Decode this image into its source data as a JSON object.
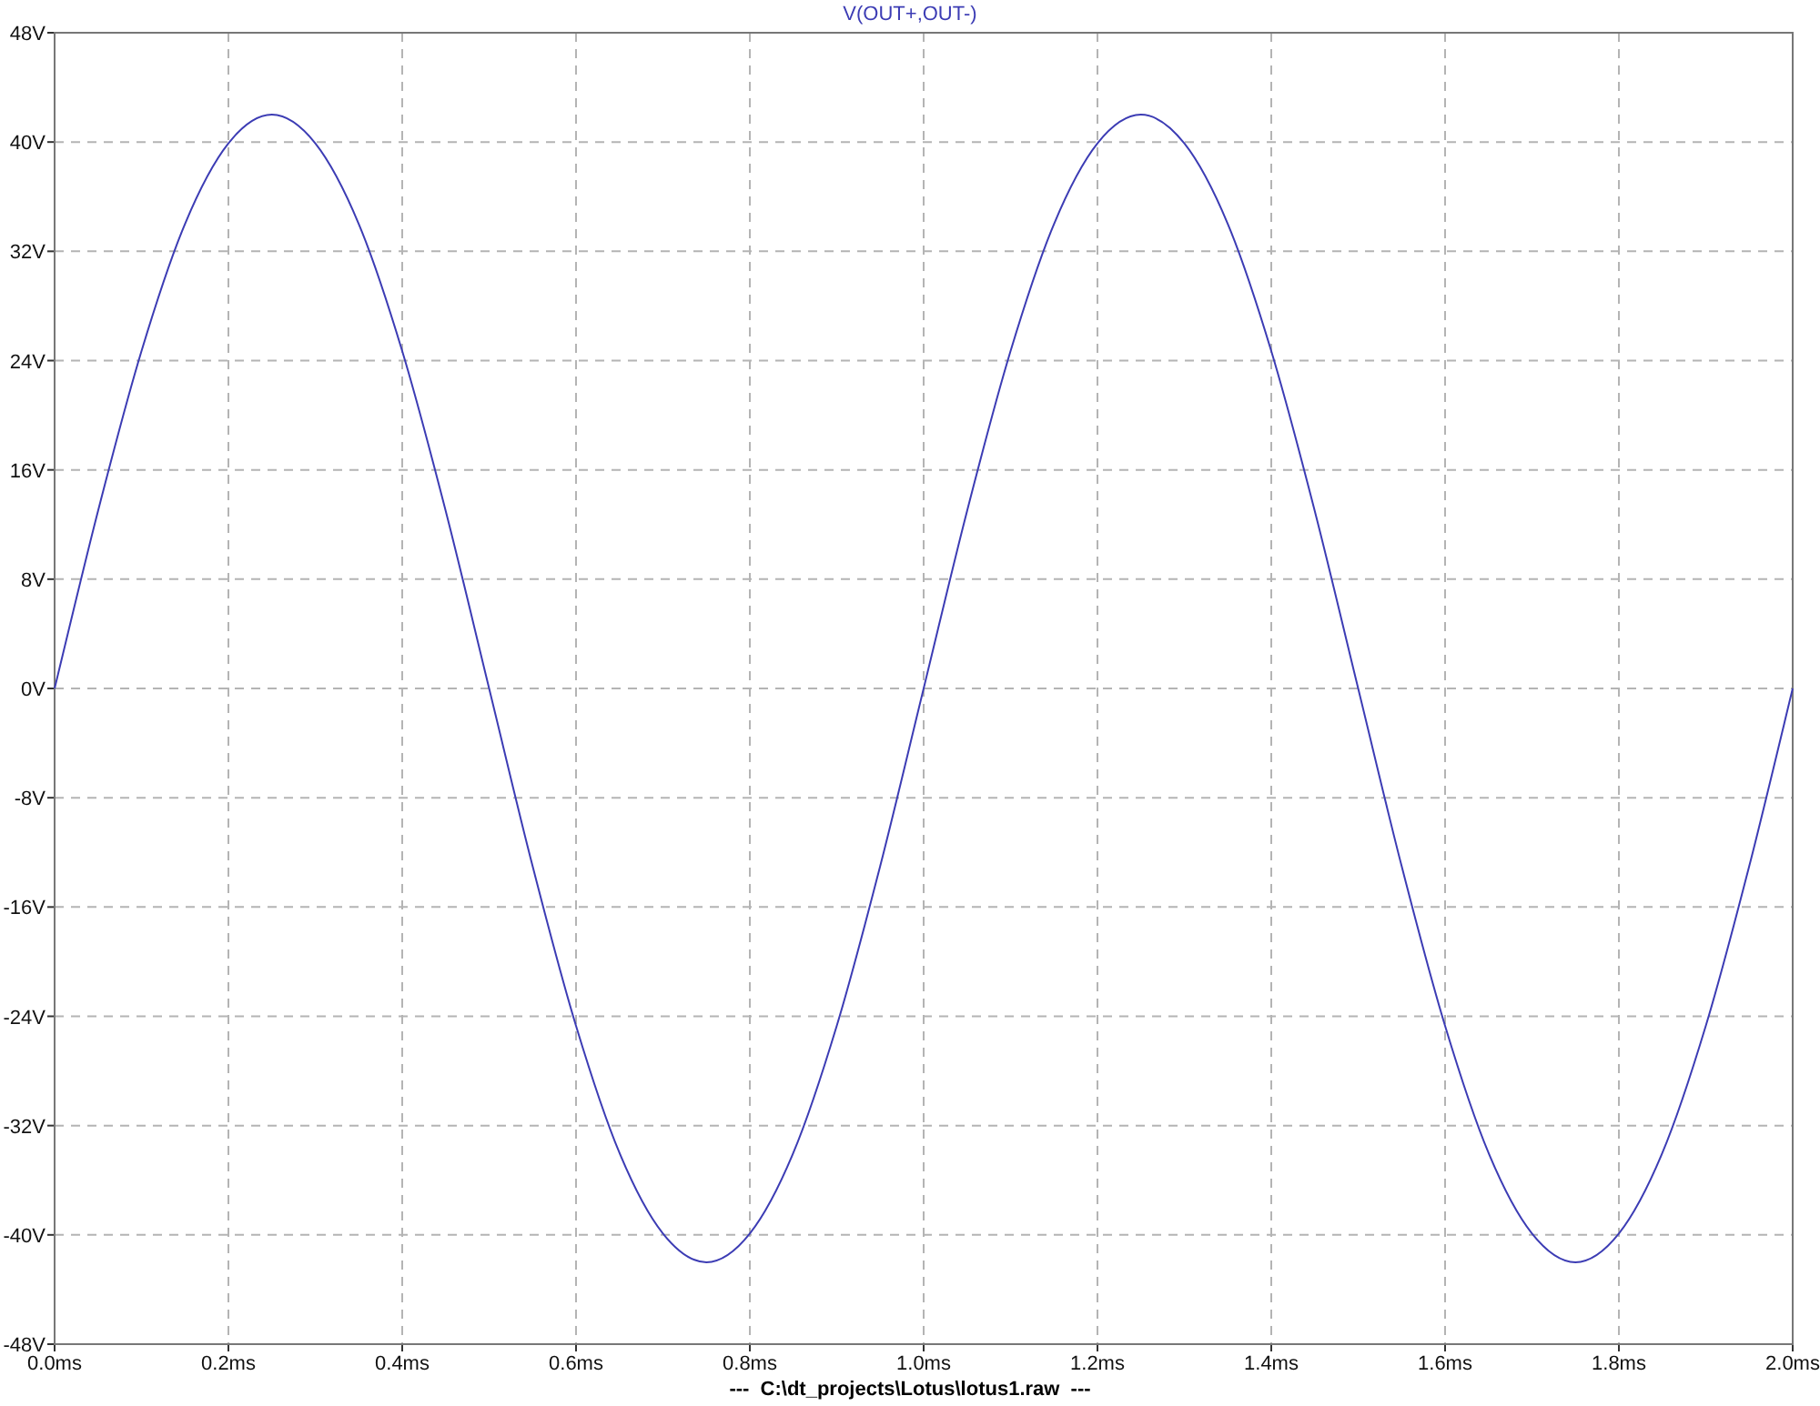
{
  "plot": {
    "chart_data": {
      "type": "line",
      "xlabel": "---  C:\\dt_projects\\Lotus\\lotus1.raw  ---",
      "grid": true,
      "xlim": [
        0,
        2
      ],
      "ylim": [
        -48,
        48
      ],
      "xticks": [
        {
          "value": 0,
          "label": "0.0ms"
        },
        {
          "value": 0.2,
          "label": "0.2ms"
        },
        {
          "value": 0.4,
          "label": "0.4ms"
        },
        {
          "value": 0.6,
          "label": "0.6ms"
        },
        {
          "value": 0.8,
          "label": "0.8ms"
        },
        {
          "value": 1,
          "label": "1.0ms"
        },
        {
          "value": 1.2,
          "label": "1.2ms"
        },
        {
          "value": 1.4,
          "label": "1.4ms"
        },
        {
          "value": 1.6,
          "label": "1.6ms"
        },
        {
          "value": 1.8,
          "label": "1.8ms"
        },
        {
          "value": 2,
          "label": "2.0ms"
        }
      ],
      "yticks": [
        {
          "value": 48,
          "label": "48V"
        },
        {
          "value": 40,
          "label": "40V"
        },
        {
          "value": 32,
          "label": "32V"
        },
        {
          "value": 24,
          "label": "24V"
        },
        {
          "value": 16,
          "label": "16V"
        },
        {
          "value": 8,
          "label": "8V"
        },
        {
          "value": 0,
          "label": "0V"
        },
        {
          "value": -8,
          "label": "-8V"
        },
        {
          "value": -16,
          "label": "-16V"
        },
        {
          "value": -24,
          "label": "-24V"
        },
        {
          "value": -32,
          "label": "-32V"
        },
        {
          "value": -40,
          "label": "-40V"
        },
        {
          "value": -48,
          "label": "-48V"
        }
      ],
      "x": [
        0,
        0.05,
        0.1,
        0.15,
        0.2,
        0.25,
        0.3,
        0.35,
        0.4,
        0.45,
        0.5,
        0.55,
        0.6,
        0.65,
        0.7,
        0.75,
        0.8,
        0.85,
        0.9,
        0.95,
        1,
        1.05,
        1.1,
        1.15,
        1.2,
        1.25,
        1.3,
        1.35,
        1.4,
        1.45,
        1.5,
        1.55,
        1.6,
        1.65,
        1.7,
        1.75,
        1.8,
        1.85,
        1.9,
        1.95,
        2
      ],
      "series": [
        {
          "name": "V(OUT+,OUT-)",
          "color": "#3c3cb4",
          "values": [
            0,
            13,
            24.7,
            34,
            39.9,
            42,
            39.9,
            34,
            24.7,
            13,
            0,
            -13,
            -24.7,
            -34,
            -39.9,
            -42,
            -39.9,
            -34,
            -24.7,
            -13,
            0,
            13,
            24.7,
            34,
            39.9,
            42,
            39.9,
            34,
            24.7,
            13,
            0,
            -13,
            -24.7,
            -34,
            -39.9,
            -42,
            -39.9,
            -34,
            -24.7,
            -13,
            0
          ]
        }
      ]
    }
  }
}
